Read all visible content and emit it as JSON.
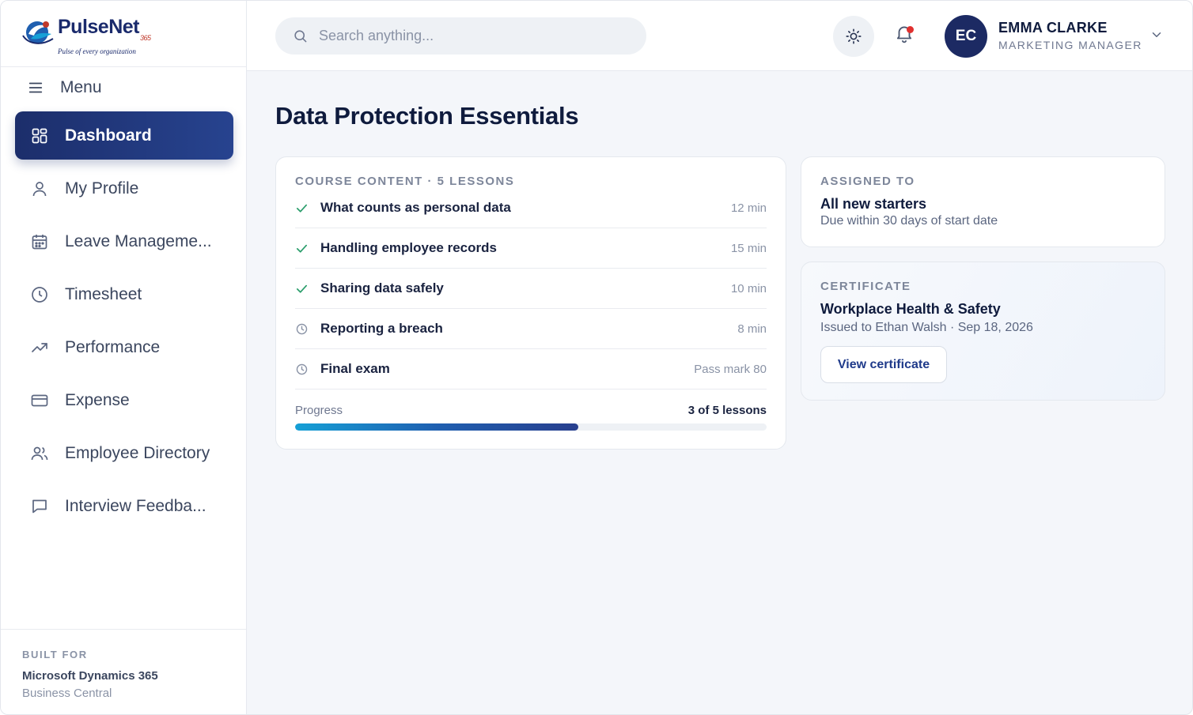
{
  "brand": {
    "name": "PulseNet",
    "superscript": "365",
    "tagline": "Pulse of every organization"
  },
  "sidebar": {
    "menu_label": "Menu",
    "items": [
      {
        "label": "Dashboard",
        "icon": "grid-icon",
        "active": true
      },
      {
        "label": "My Profile",
        "icon": "user-icon",
        "active": false
      },
      {
        "label": "Leave Manageme...",
        "icon": "calendar-icon",
        "active": false
      },
      {
        "label": "Timesheet",
        "icon": "clock-icon",
        "active": false
      },
      {
        "label": "Performance",
        "icon": "trending-up-icon",
        "active": false
      },
      {
        "label": "Expense",
        "icon": "credit-card-icon",
        "active": false
      },
      {
        "label": "Employee Directory",
        "icon": "users-icon",
        "active": false
      },
      {
        "label": "Interview Feedba...",
        "icon": "message-icon",
        "active": false
      }
    ],
    "footer": {
      "built_for_label": "BUILT FOR",
      "product": "Microsoft Dynamics 365",
      "product_sub": "Business Central"
    }
  },
  "header": {
    "search_placeholder": "Search anything...",
    "user": {
      "initials": "EC",
      "name": "EMMA CLARKE",
      "role": "MARKETING MANAGER"
    },
    "notification_badge_color": "#e0302f"
  },
  "page": {
    "title": "Data Protection Essentials"
  },
  "course": {
    "label": "COURSE CONTENT · 5 LESSONS",
    "lessons": [
      {
        "title": "What counts as personal data",
        "meta": "12 min",
        "status": "complete"
      },
      {
        "title": "Handling employee records",
        "meta": "15 min",
        "status": "complete"
      },
      {
        "title": "Sharing data safely",
        "meta": "10 min",
        "status": "complete"
      },
      {
        "title": "Reporting a breach",
        "meta": "8 min",
        "status": "pending"
      },
      {
        "title": "Final exam",
        "meta": "Pass mark 80",
        "status": "pending"
      }
    ],
    "progress_label": "Progress",
    "progress_value": "3 of 5 lessons",
    "progress_fraction": 0.6
  },
  "assigned": {
    "label": "ASSIGNED TO",
    "title": "All new starters",
    "subtitle": "Due within 30 days of start date"
  },
  "certificate": {
    "label": "CERTIFICATE",
    "title": "Workplace Health & Safety",
    "subtitle": "Issued to Ethan Walsh · Sep 18, 2026",
    "button_label": "View certificate"
  },
  "colors": {
    "primary": "#1c2e6b",
    "success": "#2a9d6b",
    "muted": "#8a93a6"
  }
}
